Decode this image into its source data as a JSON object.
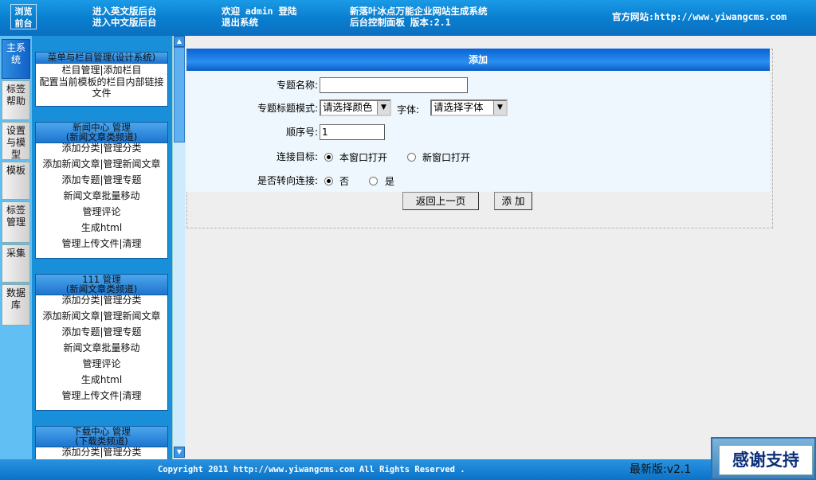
{
  "header": {
    "logo_line1": "浏览",
    "logo_line2": "前台",
    "link_en_admin": "进入英文版后台",
    "link_cn_admin": "进入中文版后台",
    "welcome": "欢迎 admin 登陆",
    "logout": "退出系统",
    "system_name": "新落叶冰点万能企业网站生成系统",
    "panel_version": "后台控制面板 版本:2.1",
    "official_site": "官方网站:http://www.yiwangcms.com"
  },
  "tabs": [
    {
      "label": "主系统"
    },
    {
      "label": "标签帮助"
    },
    {
      "label": "设置与模型"
    },
    {
      "label": "模板"
    },
    {
      "label": "标签管理"
    },
    {
      "label": "采集"
    },
    {
      "label": "数据库"
    }
  ],
  "menu": {
    "group1": {
      "title": "菜单与栏目管理(设计系统)",
      "items": [
        "栏目管理|添加栏目",
        "配置当前模板的栏目内部链接文件"
      ]
    },
    "group2": {
      "title1": "新闻中心 管理",
      "title2": "(新闻文章类频道)",
      "items": [
        "添加分类|管理分类",
        "添加新闻文章|管理新闻文章",
        "添加专题|管理专题",
        "新闻文章批量移动",
        "管理评论",
        "生成html",
        "管理上传文件|清理"
      ]
    },
    "group3": {
      "title1": "111 管理",
      "title2": "(新闻文章类频道)",
      "items": [
        "添加分类|管理分类",
        "添加新闻文章|管理新闻文章",
        "添加专题|管理专题",
        "新闻文章批量移动",
        "管理评论",
        "生成html",
        "管理上传文件|清理"
      ]
    },
    "group4": {
      "title1": "下载中心 管理",
      "title2": "(下载类频道)",
      "items": [
        "添加分类|管理分类"
      ]
    }
  },
  "form": {
    "title": "添加",
    "name_label": "专题名称:",
    "name_value": "",
    "title_mode_label": "专题标题模式:",
    "color_select": "请选择颜色",
    "font_label": "字体:",
    "font_select": "请选择字体",
    "order_label": "顺序号:",
    "order_value": "1",
    "target_label": "连接目标:",
    "target_options": [
      "本窗口打开",
      "新窗口打开"
    ],
    "target_selected": "本窗口打开",
    "redirect_label": "是否转向连接:",
    "redirect_options": [
      "否",
      "是"
    ],
    "redirect_selected": "否",
    "back_button": "返回上一页",
    "add_button": "添 加"
  },
  "footer": {
    "copyright": "Copyright 2011 http://www.yiwangcms.com All Rights Reserved .",
    "version": "最新版:v2.1",
    "thanks": "感谢支持"
  },
  "colors": {
    "header_blue": "#0a7fd0",
    "menu_blue": "#198fd9",
    "form_title": "#1a78e0"
  }
}
